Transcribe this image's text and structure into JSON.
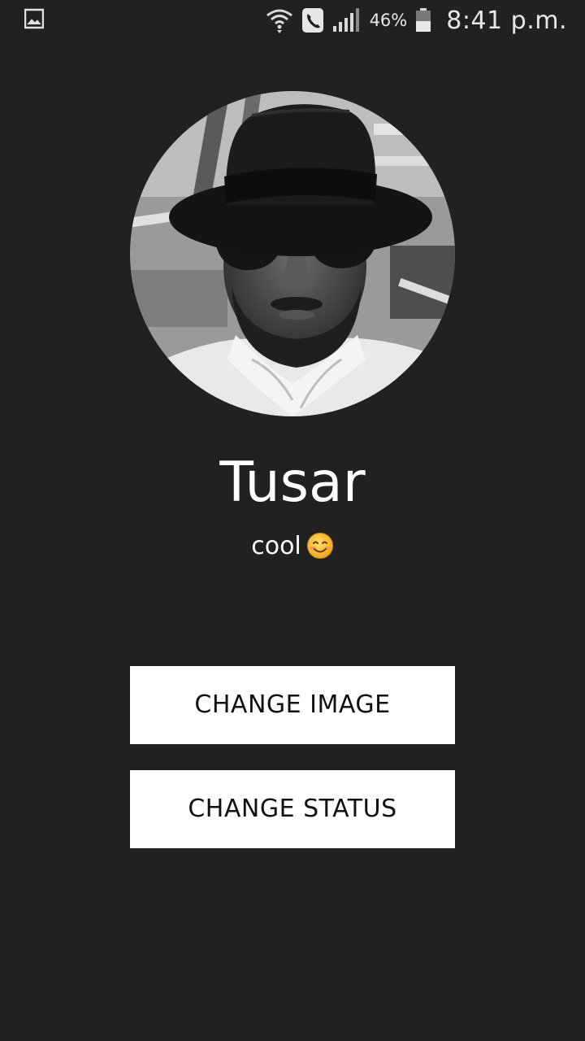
{
  "status_bar": {
    "notification_icon": "gallery-image-icon",
    "wifi_icon": "wifi-icon",
    "call_icon": "phone-call-icon",
    "signal_icon": "signal-bars-icon",
    "battery_percent": "46%",
    "battery_icon": "battery-icon",
    "time": "8:41 p.m."
  },
  "profile": {
    "avatar_icon": "profile-photo",
    "name": "Tusar",
    "status_text": "cool",
    "status_emoji": "smiling-face-emoji"
  },
  "actions": {
    "change_image_label": "CHANGE IMAGE",
    "change_status_label": "CHANGE STATUS"
  },
  "colors": {
    "background": "#212121",
    "button_background": "#ffffff",
    "button_text": "#111111",
    "text_primary": "#ffffff"
  }
}
